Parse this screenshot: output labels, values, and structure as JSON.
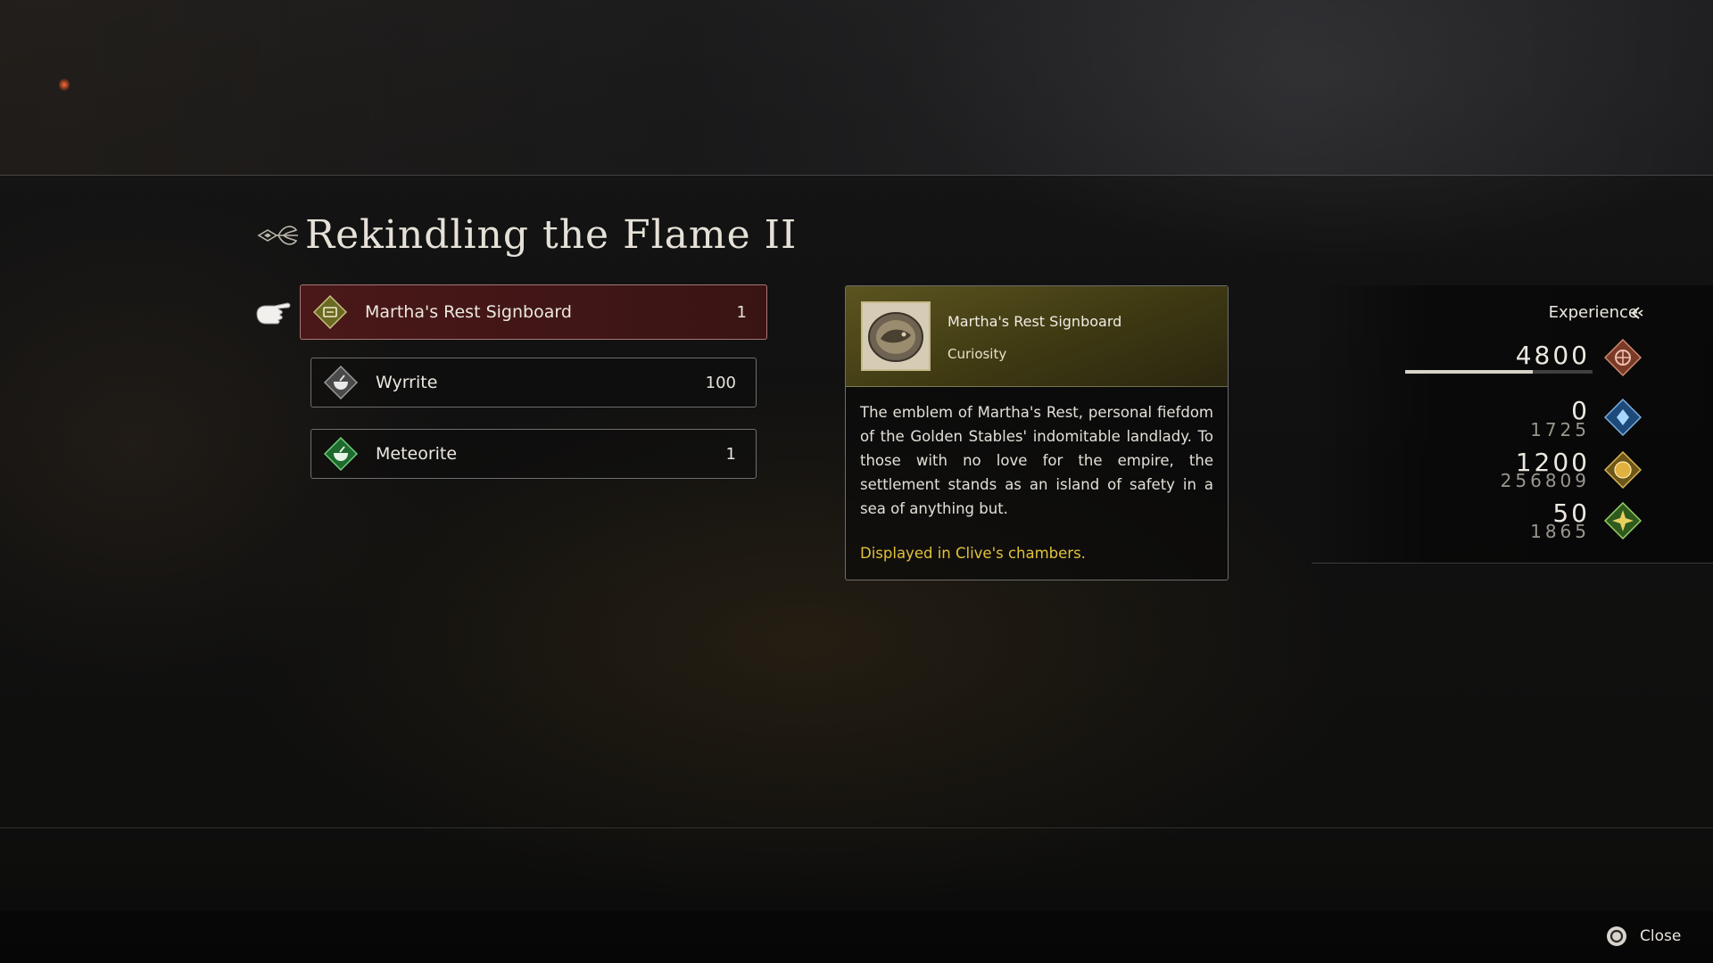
{
  "menu": {
    "title": "Rekindling the Flame II",
    "items": [
      {
        "label": "Martha's Rest Signboard",
        "qty": "1",
        "icon": "signboard-icon",
        "selected": true
      },
      {
        "label": "Wyrrite",
        "qty": "100",
        "icon": "material-bowl-icon"
      },
      {
        "label": "Meteorite",
        "qty": "1",
        "icon": "material-bowl-icon"
      }
    ]
  },
  "detail": {
    "name": "Martha's Rest Signboard",
    "category": "Curiosity",
    "description": "The emblem of Martha's Rest, personal fiefdom of the Golden Stables' indomitable landlady. To those with no love for the empire, the settlement stands as an island of safety in a sea of anything but.",
    "note": "Displayed in Clive's chambers."
  },
  "rewards": {
    "label": "Experience",
    "experience": "4800",
    "experience_progress": 0.68,
    "ability_points": {
      "value": "0",
      "total": "1725"
    },
    "gil": {
      "value": "1200",
      "total": "256809"
    },
    "renown": {
      "value": "50",
      "total": "1865"
    }
  },
  "footer": {
    "close_label": "Close"
  },
  "colors": {
    "selected_bg": "#4a1818",
    "note_gold": "#e2c23a",
    "detail_header": "#5b5420"
  }
}
